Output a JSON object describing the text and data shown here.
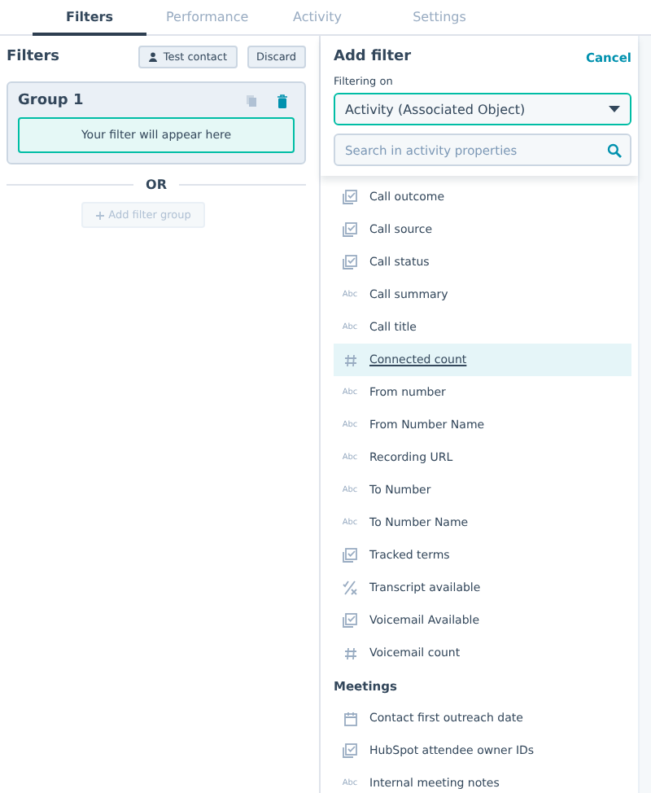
{
  "tabs": [
    {
      "label": "Filters",
      "selected": true
    },
    {
      "label": "Performance",
      "selected": false
    },
    {
      "label": "Activity",
      "selected": false
    },
    {
      "label": "Settings",
      "selected": false
    }
  ],
  "filters_panel": {
    "title": "Filters",
    "buttons": [
      "Test contact",
      "Discard"
    ],
    "group": {
      "title": "Group 1",
      "placeholder": "Your filter will appear here"
    },
    "divider_label": "OR",
    "add_button": {
      "label": "Add filter group",
      "disabled": true
    }
  },
  "add_filter": {
    "title": "Add filter",
    "cancel": "Cancel",
    "filtering_on_label": "Filtering on",
    "object_select": "Activity (Associated Object)",
    "search": {
      "placeholder": "Search in activity properties"
    },
    "sections": [
      {
        "items": [
          {
            "label": "Call outcome",
            "kind": "enumeration",
            "selected": false
          },
          {
            "label": "Call source",
            "kind": "enumeration",
            "selected": false
          },
          {
            "label": "Call status",
            "kind": "enumeration",
            "selected": false
          },
          {
            "label": "Call summary",
            "kind": "text",
            "type_label": "Abc",
            "selected": false
          },
          {
            "label": "Call title",
            "kind": "text",
            "type_label": "Abc",
            "selected": false
          },
          {
            "label": "Connected count",
            "kind": "number",
            "selected": true
          },
          {
            "label": "From number",
            "kind": "text",
            "type_label": "Abc",
            "selected": false
          },
          {
            "label": "From Number Name",
            "kind": "text",
            "type_label": "Abc",
            "selected": false
          },
          {
            "label": "Recording URL",
            "kind": "text",
            "type_label": "Abc",
            "selected": false
          },
          {
            "label": "To Number",
            "kind": "text",
            "type_label": "Abc",
            "selected": false
          },
          {
            "label": "To Number Name",
            "kind": "text",
            "type_label": "Abc",
            "selected": false
          },
          {
            "label": "Tracked terms",
            "kind": "enumeration",
            "selected": false
          },
          {
            "label": "Transcript available",
            "kind": "boolean",
            "selected": false
          },
          {
            "label": "Voicemail Available",
            "kind": "enumeration",
            "selected": false
          },
          {
            "label": "Voicemail count",
            "kind": "number",
            "selected": false
          }
        ]
      },
      {
        "heading": "Meetings",
        "items": [
          {
            "label": "Contact first outreach date",
            "kind": "date",
            "selected": false
          },
          {
            "label": "HubSpot attendee owner IDs",
            "kind": "enumeration",
            "selected": false
          },
          {
            "label": "Internal meeting notes",
            "kind": "text",
            "type_label": "Abc",
            "selected": false
          }
        ]
      }
    ]
  }
}
